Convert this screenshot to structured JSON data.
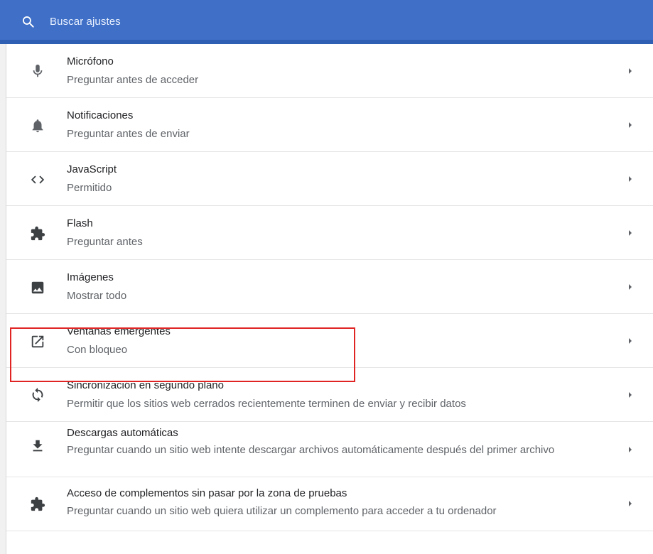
{
  "search": {
    "placeholder": "Buscar ajustes",
    "icon": "search-icon"
  },
  "settings": [
    {
      "title": "Micrófono",
      "subtitle": "Preguntar antes de acceder",
      "icon": "microphone-icon"
    },
    {
      "title": "Notificaciones",
      "subtitle": "Preguntar antes de enviar",
      "icon": "bell-icon"
    },
    {
      "title": "JavaScript",
      "subtitle": "Permitido",
      "icon": "code-icon"
    },
    {
      "title": "Flash",
      "subtitle": "Preguntar antes",
      "icon": "puzzle-icon"
    },
    {
      "title": "Imágenes",
      "subtitle": "Mostrar todo",
      "icon": "image-icon"
    },
    {
      "title": "Ventanas emergentes",
      "subtitle": "Con bloqueo",
      "icon": "open-in-new-icon"
    },
    {
      "title": "Sincronización en segundo plano",
      "subtitle": "Permitir que los sitios web cerrados recientemente terminen de enviar y recibir datos",
      "icon": "sync-icon"
    },
    {
      "title": "Descargas automáticas",
      "subtitle": "Preguntar cuando un sitio web intente descargar archivos automáticamente después del primer archivo",
      "icon": "download-icon"
    },
    {
      "title": "Acceso de complementos sin pasar por la zona de pruebas",
      "subtitle": "Preguntar cuando un sitio web quiera utilizar un complemento para acceder a tu ordenador",
      "icon": "puzzle-icon"
    }
  ],
  "colors": {
    "header": "#3f6fc6",
    "highlight": "#e02424"
  }
}
